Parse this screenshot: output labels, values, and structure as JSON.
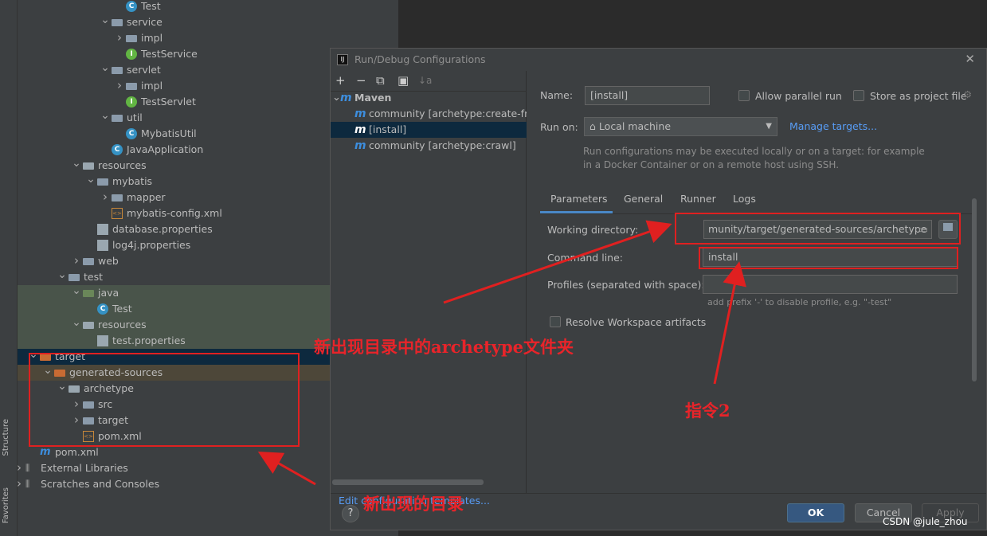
{
  "side_tabs": {
    "structure": "Structure",
    "favorites": "Favorites"
  },
  "tree": [
    {
      "label": "Test",
      "indent": 7,
      "icon": "class",
      "chevron": ""
    },
    {
      "label": "service",
      "indent": 6,
      "icon": "folder",
      "chevron": "down"
    },
    {
      "label": "impl",
      "indent": 7,
      "icon": "folder",
      "chevron": "right"
    },
    {
      "label": "TestService",
      "indent": 7,
      "icon": "interface",
      "chevron": ""
    },
    {
      "label": "servlet",
      "indent": 6,
      "icon": "folder",
      "chevron": "down"
    },
    {
      "label": "impl",
      "indent": 7,
      "icon": "folder",
      "chevron": "right"
    },
    {
      "label": "TestServlet",
      "indent": 7,
      "icon": "interface",
      "chevron": ""
    },
    {
      "label": "util",
      "indent": 6,
      "icon": "folder",
      "chevron": "down"
    },
    {
      "label": "MybatisUtil",
      "indent": 7,
      "icon": "class",
      "chevron": ""
    },
    {
      "label": "JavaApplication",
      "indent": 6,
      "icon": "class",
      "chevron": ""
    },
    {
      "label": "resources",
      "indent": 4,
      "icon": "res",
      "chevron": "down"
    },
    {
      "label": "mybatis",
      "indent": 5,
      "icon": "folder",
      "chevron": "down"
    },
    {
      "label": "mapper",
      "indent": 6,
      "icon": "folder",
      "chevron": "right"
    },
    {
      "label": "mybatis-config.xml",
      "indent": 6,
      "icon": "xml",
      "chevron": ""
    },
    {
      "label": "database.properties",
      "indent": 5,
      "icon": "prop",
      "chevron": ""
    },
    {
      "label": "log4j.properties",
      "indent": 5,
      "icon": "prop",
      "chevron": ""
    },
    {
      "label": "web",
      "indent": 4,
      "icon": "folder",
      "chevron": "right"
    },
    {
      "label": "test",
      "indent": 3,
      "icon": "folder",
      "chevron": "down"
    },
    {
      "label": "java",
      "indent": 4,
      "icon": "src",
      "chevron": "down",
      "bg": "green"
    },
    {
      "label": "Test",
      "indent": 5,
      "icon": "class",
      "chevron": "",
      "bg": "green"
    },
    {
      "label": "resources",
      "indent": 4,
      "icon": "res",
      "chevron": "down",
      "bg": "green"
    },
    {
      "label": "test.properties",
      "indent": 5,
      "icon": "prop",
      "chevron": "",
      "bg": "green"
    },
    {
      "label": "target",
      "indent": 1,
      "icon": "tgt",
      "chevron": "down",
      "bg": "sel"
    },
    {
      "label": "generated-sources",
      "indent": 2,
      "icon": "tgt",
      "chevron": "down",
      "bg": "brown"
    },
    {
      "label": "archetype",
      "indent": 3,
      "icon": "res",
      "chevron": "down"
    },
    {
      "label": "src",
      "indent": 4,
      "icon": "folder",
      "chevron": "right"
    },
    {
      "label": "target",
      "indent": 4,
      "icon": "folder",
      "chevron": "right"
    },
    {
      "label": "pom.xml",
      "indent": 4,
      "icon": "xml",
      "chevron": ""
    },
    {
      "label": "pom.xml",
      "indent": 1,
      "icon": "maven",
      "chevron": ""
    },
    {
      "label": "External Libraries",
      "indent": 0,
      "icon": "lib",
      "chevron": "right"
    },
    {
      "label": "Scratches and Consoles",
      "indent": 0,
      "icon": "lib",
      "chevron": "right"
    }
  ],
  "dialog": {
    "title": "Run/Debug Configurations",
    "logo": "IJ",
    "close": "✕",
    "toolbar": {
      "add": "+",
      "remove": "−",
      "copy": "⧉",
      "folder": "▣",
      "sort": "↓a"
    },
    "configs": [
      {
        "label": "Maven",
        "group": true
      },
      {
        "label": "community [archetype:create-fro",
        "group": false
      },
      {
        "label": "[install]",
        "group": false,
        "selected": true
      },
      {
        "label": "community [archetype:crawl]",
        "group": false
      }
    ],
    "edit_templates": "Edit configuration templates...",
    "name_label": "Name:",
    "name_value": "[install]",
    "allow_parallel": "Allow parallel run",
    "store_project": "Store as project file",
    "run_on_label": "Run on:",
    "run_on_value": "Local machine",
    "manage_targets": "Manage targets...",
    "hint": "Run configurations may be executed locally or on a target: for example in a Docker Container or on a remote host using SSH.",
    "tabs": [
      "Parameters",
      "General",
      "Runner",
      "Logs"
    ],
    "working_dir_label": "Working directory:",
    "working_dir_value": "munity/target/generated-sources/archetype",
    "command_line_label": "Command line:",
    "command_line_value": "install",
    "profiles_label": "Profiles (separated with space):",
    "profiles_value": "",
    "profiles_hint": "add prefix '-' to disable profile, e.g. \"-test\"",
    "resolve_workspace": "Resolve Workspace artifacts",
    "help": "?",
    "ok": "OK",
    "cancel": "Cancel",
    "apply": "Apply"
  },
  "annotations": {
    "archetype_folder": "新出现目录中的archetype文件夹",
    "command2": "指令2",
    "new_dir": "新出现的目录",
    "color": "#e02020"
  },
  "watermark": "CSDN @jule_zhou"
}
